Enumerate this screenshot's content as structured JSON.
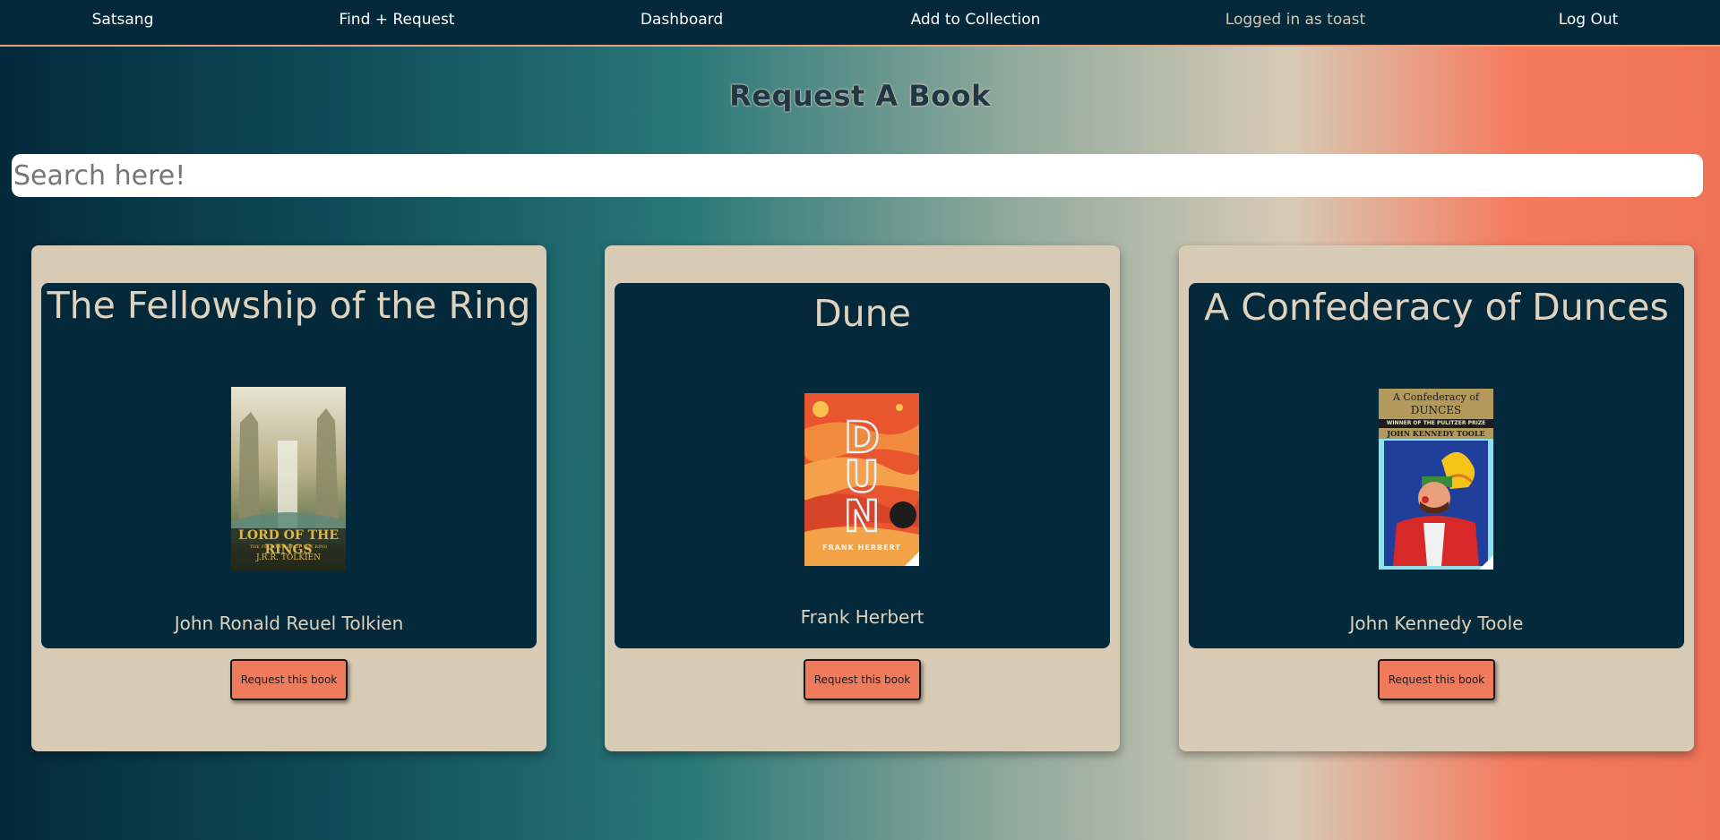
{
  "nav": {
    "brand": "Satsang",
    "find_request": "Find + Request",
    "dashboard": "Dashboard",
    "add_collection": "Add to Collection",
    "status": "Logged in as toast",
    "logout": "Log Out"
  },
  "main": {
    "title": "Request A Book",
    "search_placeholder": "Search here!",
    "request_label": "Request this book"
  },
  "books": [
    {
      "title": "The Fellowship of the Ring",
      "author": "John Ronald Reuel Tolkien",
      "cover_text": [
        "LORD OF THE RINGS",
        "THE FELLOWSHIP OF THE RING",
        "J.R.R. TOLKIEN"
      ]
    },
    {
      "title": "Dune",
      "author": "Frank Herbert",
      "cover_text": [
        "DUNE",
        "FRANK HERBERT"
      ]
    },
    {
      "title": "A Confederacy of Dunces",
      "author": "John Kennedy Toole",
      "cover_text": [
        "A Confederacy of",
        "DUNCES",
        "WINNER OF THE PULITZER PRIZE",
        "JOHN KENNEDY TOOLE"
      ]
    }
  ],
  "colors": {
    "navbar": "#04293b",
    "card": "#d8cbb5",
    "card_inner": "#04293b",
    "button": "#f07a5c",
    "gradient_start": "#03293b",
    "gradient_end": "#f07358"
  }
}
